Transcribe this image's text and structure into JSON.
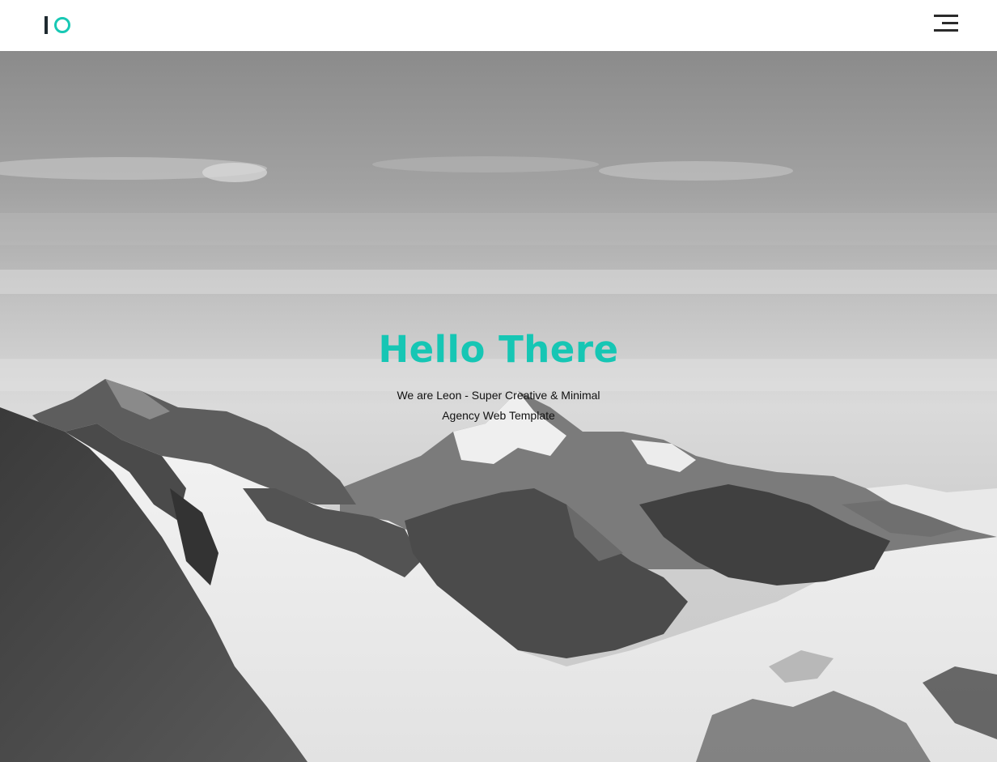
{
  "header": {
    "logo_icon": "io-logo",
    "menu_icon": "hamburger-menu-icon"
  },
  "hero": {
    "title": "Hello There",
    "subtitle": "We are Leon - Super Creative & Minimal Agency Web Template",
    "background_image": "black-and-white snowy mountain range under cloudy sky"
  },
  "colors": {
    "accent": "#16c6b4",
    "text": "#111111",
    "header_bg": "#ffffff"
  }
}
